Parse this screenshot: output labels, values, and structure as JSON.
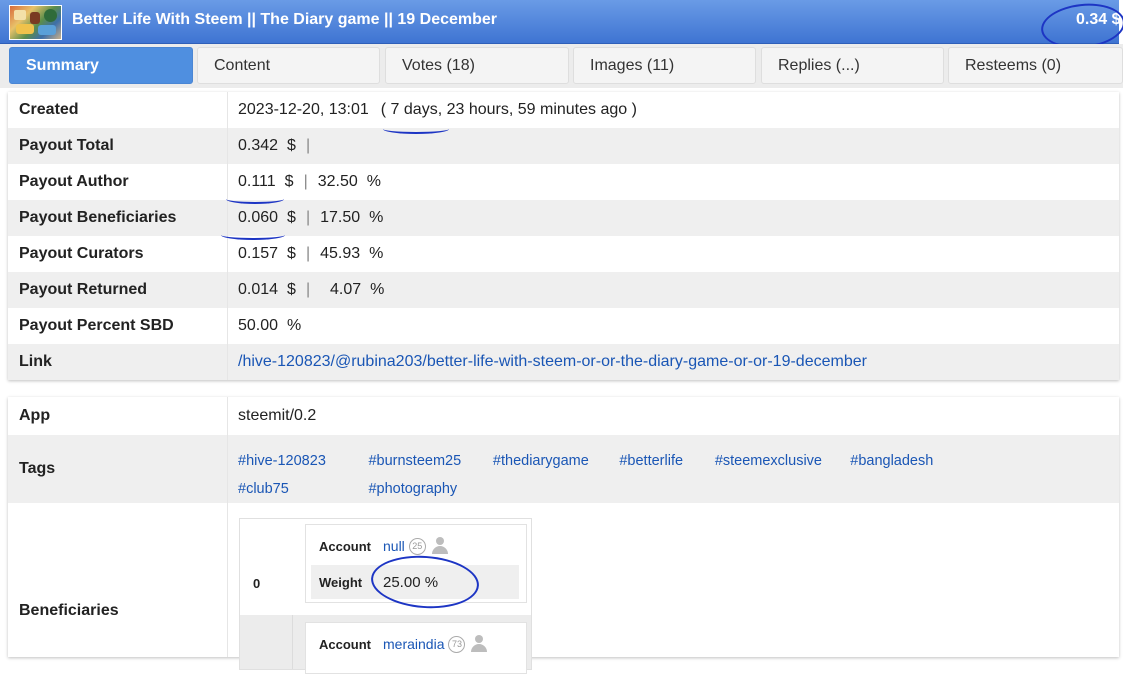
{
  "header": {
    "title": "Better Life With Steem || The Diary game || 19 December",
    "payout": "0.34 $"
  },
  "tabs": [
    {
      "label": "Summary"
    },
    {
      "label": "Content"
    },
    {
      "label": "Votes (18)"
    },
    {
      "label": "Images (11)"
    },
    {
      "label": "Replies (...)"
    },
    {
      "label": "Resteems (0)"
    }
  ],
  "summary": {
    "created": {
      "label": "Created",
      "date": "2023-12-20, 13:01",
      "ago": "( 7 days, 23 hours, 59 minutes ago )"
    },
    "payout_total": {
      "label": "Payout Total",
      "value": "0.342",
      "unit": "$",
      "sep": "|"
    },
    "payout_author": {
      "label": "Payout Author",
      "value": "0.111",
      "unit": "$",
      "sep": "|",
      "pct": "32.50",
      "pct_unit": "%"
    },
    "payout_beneficiaries": {
      "label": "Payout Beneficiaries",
      "value": "0.060",
      "unit": "$",
      "sep": "|",
      "pct": "17.50",
      "pct_unit": "%"
    },
    "payout_curators": {
      "label": "Payout Curators",
      "value": "0.157",
      "unit": "$",
      "sep": "|",
      "pct": "45.93",
      "pct_unit": "%"
    },
    "payout_returned": {
      "label": "Payout Returned",
      "value": "0.014",
      "unit": "$",
      "sep": "|",
      "pct": "4.07",
      "pct_unit": "%"
    },
    "payout_percent_sbd": {
      "label": "Payout Percent SBD",
      "value": "50.00",
      "unit": "%"
    },
    "link": {
      "label": "Link",
      "url": "/hive-120823/@rubina203/better-life-with-steem-or-or-the-diary-game-or-or-19-december"
    }
  },
  "details": {
    "app": {
      "label": "App",
      "value": "steemit/0.2"
    },
    "tags": {
      "label": "Tags",
      "items": [
        "#hive-120823",
        "#burnsteem25",
        "#thediarygame",
        "#betterlife",
        "#steemexclusive",
        "#bangladesh",
        "#club75",
        "#photography"
      ]
    },
    "beneficiaries": {
      "label": "Beneficiaries",
      "entries": [
        {
          "index": "0",
          "account_label": "Account",
          "account": "null",
          "reputation": "25",
          "weight_label": "Weight",
          "weight": "25.00 %"
        },
        {
          "index": "",
          "account_label": "Account",
          "account": "meraindia",
          "reputation": "73"
        }
      ]
    }
  },
  "colors": {
    "header": "#4f86dc",
    "accent": "#4f8fe0",
    "link": "#1a56b5",
    "annotation": "#1d35c4"
  }
}
